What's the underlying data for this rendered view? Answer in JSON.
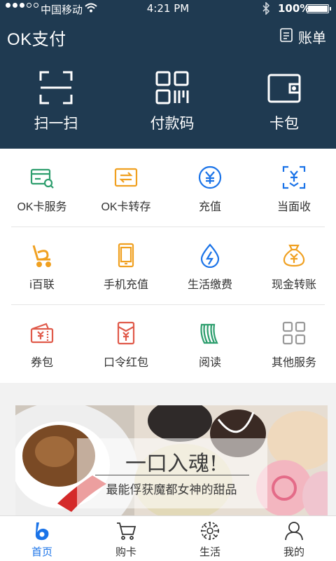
{
  "status_bar": {
    "carrier": "中国移动",
    "time": "4:21 PM",
    "battery": "100%"
  },
  "header": {
    "title": "OK支付",
    "bill_label": "账单"
  },
  "quick_actions": [
    {
      "label": "扫一扫",
      "icon": "scan-icon"
    },
    {
      "label": "付款码",
      "icon": "qr-code-icon"
    },
    {
      "label": "卡包",
      "icon": "wallet-icon"
    }
  ],
  "services": [
    {
      "label": "OK卡服务",
      "icon": "card-search-icon",
      "color": "#2e9e6e"
    },
    {
      "label": "OK卡转存",
      "icon": "card-transfer-icon",
      "color": "#f0a020"
    },
    {
      "label": "充值",
      "icon": "yuan-circle-icon",
      "color": "#1a73e8"
    },
    {
      "label": "当面收",
      "icon": "receive-scan-icon",
      "color": "#1a73e8"
    },
    {
      "label": "i百联",
      "icon": "cart-logo-icon",
      "color": "#f0a020"
    },
    {
      "label": "手机充值",
      "icon": "phone-icon",
      "color": "#f0a020"
    },
    {
      "label": "生活缴费",
      "icon": "utility-drop-icon",
      "color": "#1a73e8"
    },
    {
      "label": "现金转账",
      "icon": "money-bag-icon",
      "color": "#f0a020"
    },
    {
      "label": "券包",
      "icon": "coupon-icon",
      "color": "#e05a4a"
    },
    {
      "label": "口令红包",
      "icon": "red-envelope-icon",
      "color": "#e05a4a"
    },
    {
      "label": "阅读",
      "icon": "reading-icon",
      "color": "#2e9e6e"
    },
    {
      "label": "其他服务",
      "icon": "grid-more-icon",
      "color": "#999999"
    }
  ],
  "banner": {
    "headline": "一口入魂!",
    "subline": "最能俘获魔都女神的甜品"
  },
  "tabs": [
    {
      "label": "首页",
      "icon": "home-logo-icon",
      "active": true
    },
    {
      "label": "购卡",
      "icon": "cart-icon",
      "active": false
    },
    {
      "label": "生活",
      "icon": "life-flower-icon",
      "active": false
    },
    {
      "label": "我的",
      "icon": "user-icon",
      "active": false
    }
  ],
  "colors": {
    "header_bg": "#1f3a51",
    "accent": "#1a73e8"
  }
}
